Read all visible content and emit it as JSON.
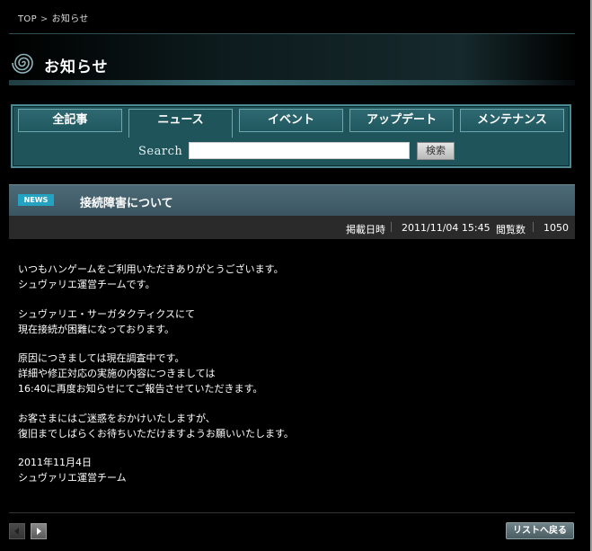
{
  "breadcrumb": {
    "home": "TOP",
    "separator": ">",
    "current": "お知らせ"
  },
  "header": {
    "title": "お知らせ"
  },
  "tabs": [
    {
      "label": "全記事"
    },
    {
      "label": "ニュース"
    },
    {
      "label": "イベント"
    },
    {
      "label": "アップデート"
    },
    {
      "label": "メンテナンス"
    }
  ],
  "search": {
    "label": "Search",
    "value": "",
    "button": "検索"
  },
  "article": {
    "badge": "NEWS",
    "title": "接続障害について",
    "meta": {
      "date_label": "掲載日時",
      "date": "2011/11/04 15:45",
      "views_label": "閲覧数",
      "views": "1050"
    },
    "paragraphs": [
      [
        "いつもハンゲームをご利用いただきありがとうございます。",
        "シュヴァリエ運営チームです。"
      ],
      [
        "シュヴァリエ・サーガタクティクスにて",
        "現在接続が困難になっております。"
      ],
      [
        "原因につきましては現在調査中です。",
        "詳細や修正対応の実施の内容につきましては",
        "16:40に再度お知らせにてご報告させていただきます。"
      ],
      [
        "お客さまにはご迷惑をおかけいたしますが、",
        "復旧までしばらくお待ちいただけますようお願いいたします。"
      ],
      [
        "2011年11月4日",
        "シュヴァリエ運営チーム"
      ]
    ]
  },
  "footer": {
    "back_to_list": "リストへ戻る"
  },
  "colors": {
    "accent": "#1f545b",
    "badge": "#24a2c2",
    "header_bar": "#4c6a76"
  }
}
